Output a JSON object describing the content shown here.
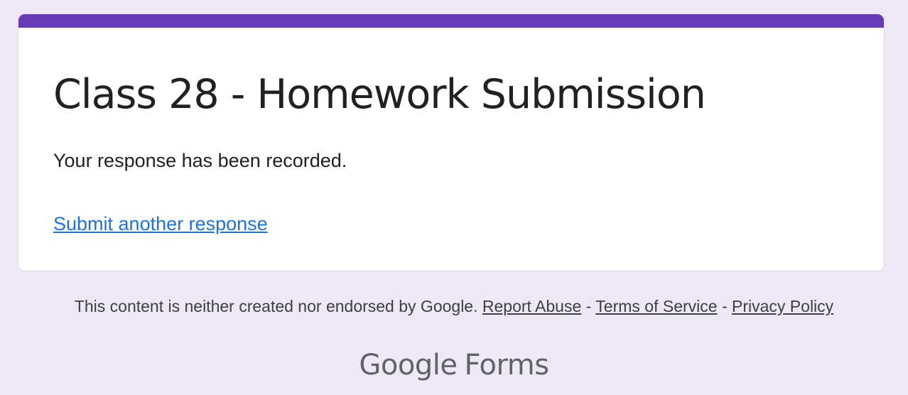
{
  "colors": {
    "page_background": "#ede7f6",
    "accent": "#673ab7",
    "link": "#1a73e8",
    "text": "#202124",
    "footer_text": "#3c4043",
    "brand_text": "#5f6368"
  },
  "form": {
    "title": "Class 28 - Homework Submission",
    "confirmation_message": "Your response has been recorded.",
    "submit_another_label": "Submit another response"
  },
  "footer": {
    "disclaimer": "This content is neither created nor endorsed by Google.",
    "separator": "-",
    "links": {
      "report_abuse": "Report Abuse",
      "terms_of_service": "Terms of Service",
      "privacy_policy": "Privacy Policy"
    }
  },
  "brand": {
    "google": "Google",
    "product": "Forms"
  }
}
